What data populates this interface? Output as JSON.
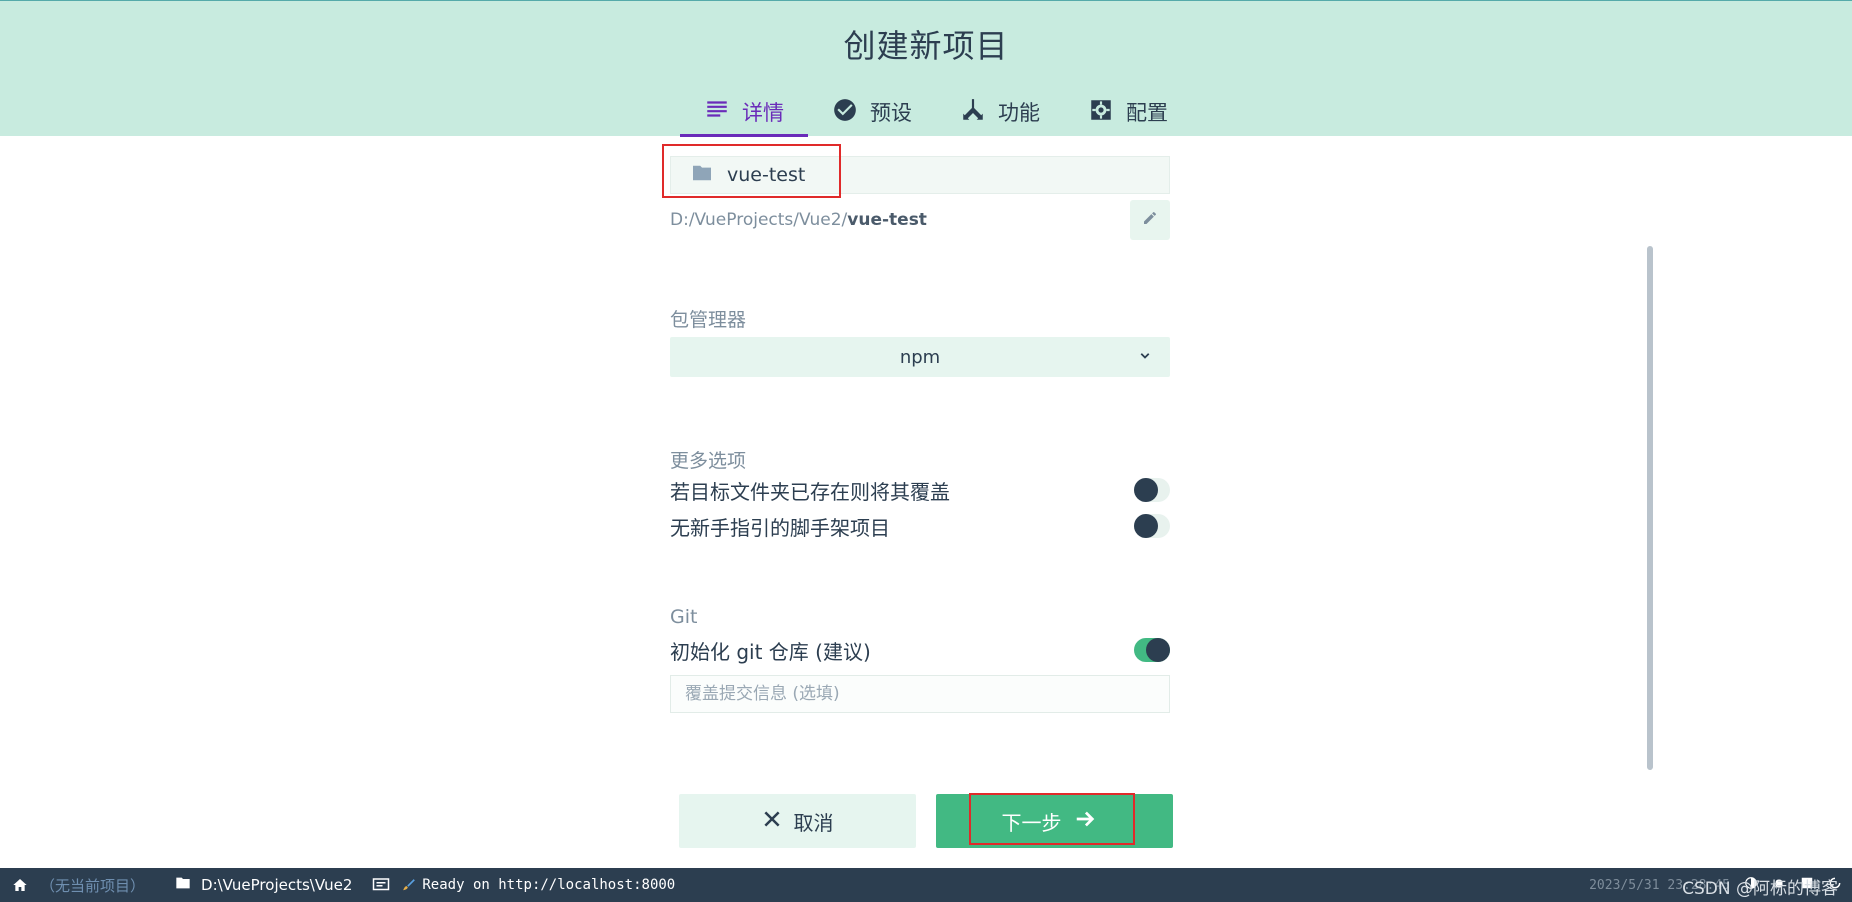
{
  "header": {
    "title": "创建新项目",
    "tabs": [
      {
        "label": "详情",
        "icon": "details-list-icon",
        "active": true
      },
      {
        "label": "预设",
        "icon": "check-circle-icon",
        "active": false
      },
      {
        "label": "功能",
        "icon": "fork-icon",
        "active": false
      },
      {
        "label": "配置",
        "icon": "gear-icon",
        "active": false
      }
    ]
  },
  "details": {
    "folder_name": "vue-test",
    "path_prefix": "D:/VueProjects/Vue2/",
    "path_name": "vue-test",
    "package_manager_label": "包管理器",
    "package_manager_value": "npm",
    "more_options_label": "更多选项",
    "options": [
      {
        "label": "若目标文件夹已存在则将其覆盖",
        "enabled": false
      },
      {
        "label": "无新手指引的脚手架项目",
        "enabled": false
      }
    ],
    "git_label": "Git",
    "git_init_label": "初始化 git 仓库 (建议)",
    "git_init_enabled": true,
    "commit_placeholder": "覆盖提交信息 (选填)"
  },
  "actions": {
    "cancel_label": "取消",
    "next_label": "下一步"
  },
  "statusbar": {
    "current_project": "（无当前项目）",
    "folder": "D:\\VueProjects\\Vue2",
    "log_message": "Ready on http://localhost:8000",
    "timestamp": "2023/5/31 23:28:45",
    "watermark": "CSDN @阿标的博客"
  },
  "colors": {
    "header_bg": "#c8ebdf",
    "accent": "#6a2bb9",
    "primary": "#42b983",
    "dark": "#2c3e50",
    "highlight_box": "#e02a2a"
  }
}
